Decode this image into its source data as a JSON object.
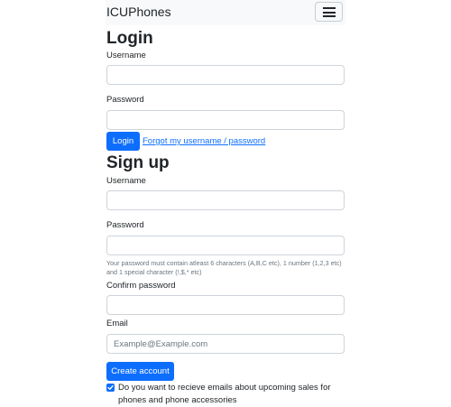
{
  "navbar": {
    "brand": "ICUPhones",
    "toggler_icon": "hamburger-icon"
  },
  "login": {
    "title": "Login",
    "username_label": "Username",
    "username_value": "",
    "password_label": "Password",
    "password_value": "",
    "submit_label": "Login",
    "forgot_link": "Forgot my username / password"
  },
  "signup": {
    "title": "Sign up",
    "username_label": "Username",
    "username_value": "",
    "password_label": "Password",
    "password_value": "",
    "password_help": "Your password must contain atleast 6 characters (A,B,C etc), 1 number (1,2,3 etc) and 1 special character (!,$,* etc)",
    "confirm_label": "Confirm password",
    "confirm_value": "",
    "email_label": "Email",
    "email_placeholder": "Example@Example.com",
    "submit_label": "Create account",
    "newsletter_label": "Do you want to recieve emails about upcoming sales for phones and phone accessories",
    "newsletter_checked": true
  },
  "colors": {
    "primary": "#0d6efd",
    "navbar_bg": "#f8f9fa",
    "text": "#212529",
    "muted": "#6c757d",
    "border": "#ced4da"
  }
}
